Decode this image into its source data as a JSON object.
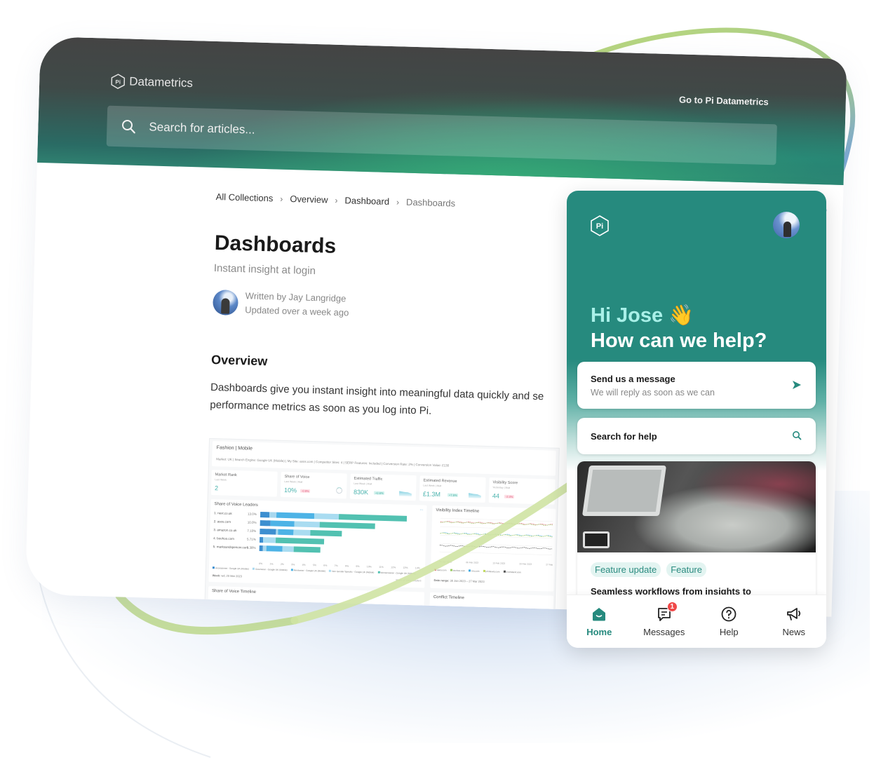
{
  "header": {
    "logo_text": "Datametrics",
    "logo_glyph": "Pi",
    "goto_link": "Go to Pi Datametrics",
    "search_placeholder": "Search for articles..."
  },
  "breadcrumb": [
    {
      "label": "All Collections"
    },
    {
      "label": "Overview"
    },
    {
      "label": "Dashboard"
    },
    {
      "label": "Dashboards"
    }
  ],
  "article": {
    "title": "Dashboards",
    "subtitle": "Instant insight at login",
    "author_line": "Written by Jay Langridge",
    "updated_line": "Updated over a week ago",
    "section_heading": "Overview",
    "body_line1": "Dashboards give you instant insight into meaningful data quickly and se",
    "body_line2": "performance metrics as soon as you log into Pi."
  },
  "dashboard_preview": {
    "title": "Fashion | Mobile",
    "meta": "Market: UK | Search Engine: Google UK (Mobile) | My Site: asos.com | Competitor Sites: 4 | SERP Features: Included | Conversion Rate: 2% | Conversion Value: £130",
    "kpis": [
      {
        "label": "Market Rank",
        "sub": "Last Week",
        "value": "2",
        "badge": "",
        "badge_type": "",
        "visual": "none"
      },
      {
        "label": "Share of Voice",
        "sub": "Last Week | Mult",
        "value": "10%",
        "badge": "-0.9%",
        "badge_type": "neg",
        "visual": "ring"
      },
      {
        "label": "Estimated Traffic",
        "sub": "Last Week | Mult",
        "value": "830K",
        "badge": "+3.6%",
        "badge_type": "pos",
        "visual": "spark"
      },
      {
        "label": "Estimated Revenue",
        "sub": "Last Week | Mult",
        "value": "£1.3M",
        "badge": "+7.6%",
        "badge_type": "pos",
        "visual": "spark"
      },
      {
        "label": "Visibility Score",
        "sub": "Yesterday | Mult",
        "value": "44",
        "badge": "-2.4%",
        "badge_type": "neg",
        "visual": "none"
      }
    ],
    "leaders_panel": {
      "title": "Share of Voice Leaders",
      "more": "...",
      "x_ticks": [
        "0%",
        "1%",
        "2%",
        "3%",
        "4%",
        "5%",
        "6%",
        "7%",
        "8%",
        "9%",
        "10%",
        "11%",
        "12%",
        "13%",
        "14%"
      ],
      "x_max": 14,
      "series_colors": [
        "#3d8fd0",
        "#a8d8ef",
        "#4db3e6",
        "#a9dcf1",
        "#52c1b1"
      ],
      "legend": [
        "Accessories - Google UK (Mobile)",
        "Outerwear - Google UK (Mobile)",
        "Menswear - Google UK (Mobile)",
        "Non Gender Specific - Google UK (Mobile)",
        "Womenswear - Google UK (Mobile)"
      ],
      "rows": [
        {
          "name": "1. next.co.uk",
          "pct": "13.0%",
          "segments": [
            0.8,
            0.6,
            3.3,
            2.1,
            5.9
          ]
        },
        {
          "name": "2. asos.com",
          "pct": "10.0%",
          "segments": [
            0.9,
            0,
            2.1,
            2.2,
            4.8
          ]
        },
        {
          "name": "3. amazon.co.uk",
          "pct": "7.10%",
          "segments": [
            1.4,
            0.2,
            1.3,
            1.5,
            2.7
          ]
        },
        {
          "name": "4. boohoo.com",
          "pct": "5.71%",
          "segments": [
            0.3,
            0,
            0,
            1.1,
            4.2
          ]
        },
        {
          "name": "5. marksandspencer.com",
          "pct": "5.38%",
          "segments": [
            0.3,
            0.3,
            1.4,
            1.0,
            2.3
          ]
        }
      ],
      "footer_label": "Week:",
      "footer_value": "w/c 20 Mar 2023",
      "footer_right": "Share of Voice Leaders"
    },
    "visibility_panel": {
      "title": "Visibility Index Timeline",
      "x_ticks": [
        "30 Jan 2023",
        "06 Feb 2023",
        "13 Feb 2023",
        "20 Feb 2023",
        "27 Feb 2023"
      ],
      "legend": [
        {
          "name": "asos.com",
          "color": "#e05a73"
        },
        {
          "name": "boohoo.com",
          "color": "#9ccc65"
        },
        {
          "name": "hm.com",
          "color": "#3fa9e0"
        },
        {
          "name": "johnlewis.com",
          "color": "#c0d860"
        },
        {
          "name": "riverisland.com",
          "color": "#555555"
        }
      ],
      "series_levels": [
        0.72,
        0.71,
        0.45,
        0.44,
        0.15
      ],
      "footer_label": "Date range:",
      "footer_value": "30 Jan 2023 – 27 Mar 2023"
    },
    "timeline_panels": [
      {
        "title": "Share of Voice Timeline"
      },
      {
        "title": "Conflict Timeline"
      }
    ]
  },
  "messenger": {
    "greeting_line1": "Hi Jose 👋",
    "greeting_line2": "How can we help?",
    "send_title": "Send us a message",
    "send_sub": "We will reply as soon as we can",
    "search_help": "Search for help",
    "news_tags": [
      "Feature update",
      "Feature"
    ],
    "news_title": "Seamless workflows from insights to",
    "accent_color": "#268a7e",
    "nav": [
      {
        "label": "Home",
        "icon": "home-icon",
        "active": true
      },
      {
        "label": "Messages",
        "icon": "messages-icon",
        "badge": "1"
      },
      {
        "label": "Help",
        "icon": "help-icon"
      },
      {
        "label": "News",
        "icon": "megaphone-icon"
      }
    ]
  }
}
